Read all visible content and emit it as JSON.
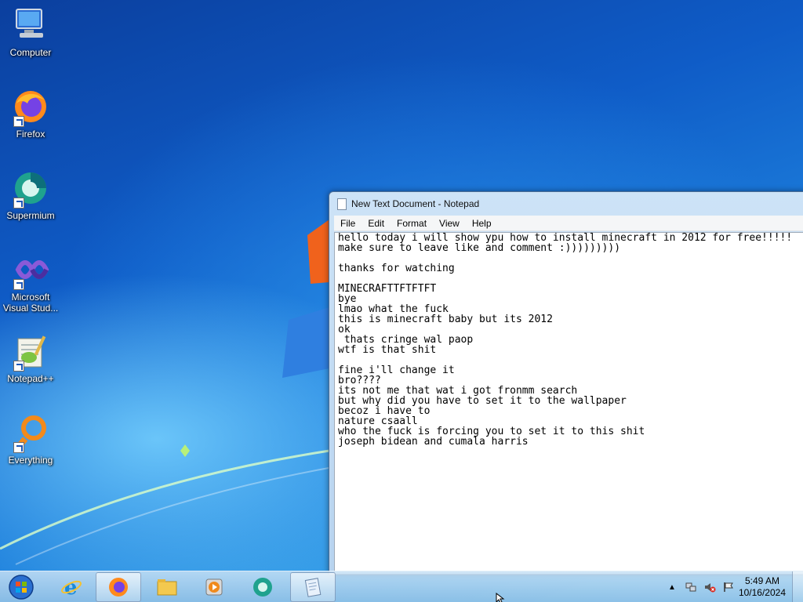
{
  "desktop": {
    "icons": [
      {
        "label": "Computer",
        "icon": "computer-icon"
      },
      {
        "label": "Firefox",
        "icon": "firefox-icon"
      },
      {
        "label": "Supermium",
        "icon": "supermium-icon"
      },
      {
        "label": "Microsoft Visual Stud...",
        "icon": "visual-studio-icon"
      },
      {
        "label": "Notepad++",
        "icon": "notepad-plus-plus-icon"
      },
      {
        "label": "Everything",
        "icon": "everything-search-icon"
      }
    ]
  },
  "notepad": {
    "title": "New Text Document - Notepad",
    "menu": [
      "File",
      "Edit",
      "Format",
      "View",
      "Help"
    ],
    "content": "hello today i will show ypu how to install minecraft in 2012 for free!!!!!\nmake sure to leave like and comment :)))))))))\n\nthanks for watching\n\nMINECRAFTTFTFTFT\nbye\nlmao what the fuck\nthis is minecraft baby but its 2012\nok\n thats cringe wal paop\nwtf is that shit\n\nfine i'll change it\nbro????\nits not me that wat i got fronmm search\nbut why did you have to set it to the wallpaper\nbecoz i have to\nnature csaall\nwho the fuck is forcing you to set it to this shit\njoseph bidean and cumala harris"
  },
  "taskbar": {
    "buttons": [
      {
        "icon": "internet-explorer-icon",
        "active": false
      },
      {
        "icon": "firefox-icon",
        "active": true
      },
      {
        "icon": "file-explorer-icon",
        "active": false
      },
      {
        "icon": "media-player-icon",
        "active": false
      },
      {
        "icon": "supermium-icon",
        "active": false
      },
      {
        "icon": "notepad-icon",
        "active": true
      }
    ],
    "clock": {
      "time": "5:49 AM",
      "date": "10/16/2024"
    }
  },
  "colors": {
    "accent": "#1d6fd0",
    "taskbar": "#b8d6ef"
  }
}
